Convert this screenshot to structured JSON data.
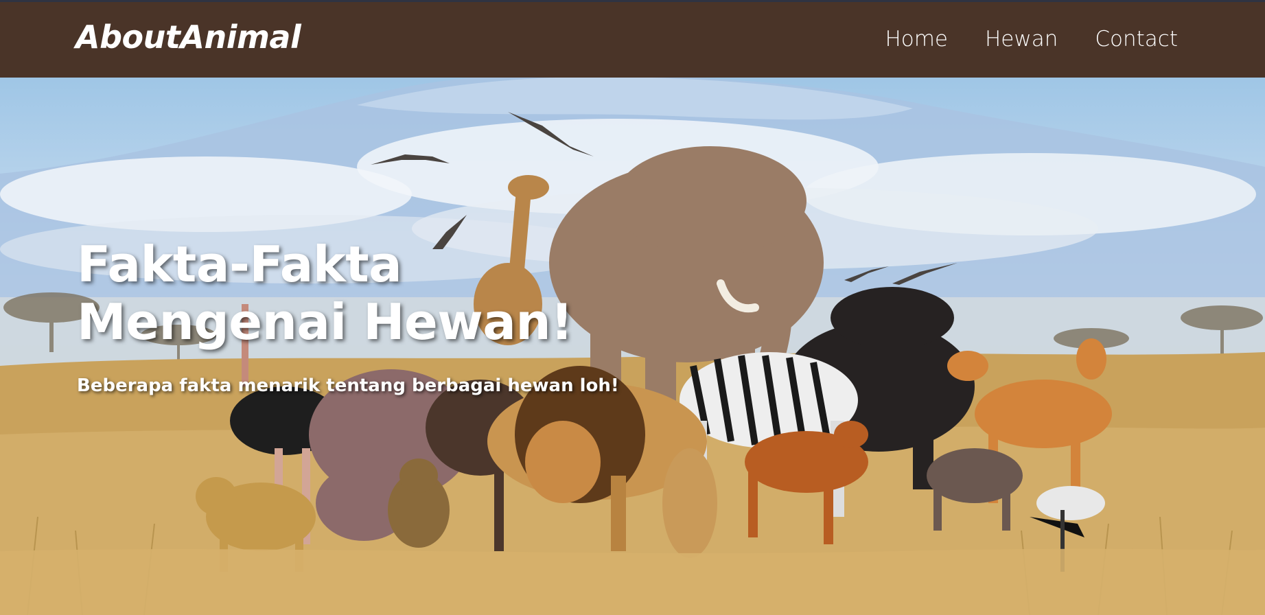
{
  "navbar": {
    "brand": "AboutAnimal",
    "links": [
      {
        "label": "Home"
      },
      {
        "label": "Hewan"
      },
      {
        "label": "Contact"
      }
    ],
    "background_color": "#4a3428"
  },
  "hero": {
    "title_line1": "Fakta-Fakta",
    "title_line2": "Mengenai Hewan!",
    "subtitle": "Beberapa fakta menarik tentang berbagai hewan loh!"
  }
}
